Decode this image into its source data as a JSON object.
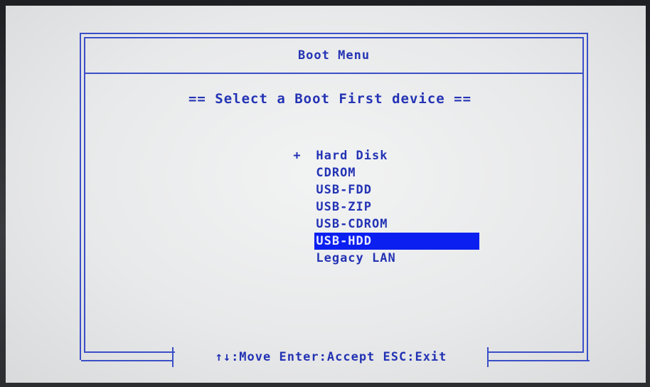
{
  "menu": {
    "title": "Boot Menu",
    "heading": "== Select a Boot First device ==",
    "marker": "+",
    "devices": [
      {
        "label": "Hard Disk",
        "marker": "+"
      },
      {
        "label": "CDROM",
        "marker": ""
      },
      {
        "label": "USB-FDD",
        "marker": ""
      },
      {
        "label": "USB-ZIP",
        "marker": ""
      },
      {
        "label": "USB-CDROM",
        "marker": ""
      },
      {
        "label": "USB-HDD",
        "marker": ""
      },
      {
        "label": "Legacy LAN",
        "marker": ""
      }
    ],
    "selected_label": "USB-HDD"
  },
  "help": {
    "text": "↑↓:Move Enter:Accept ESC:Exit"
  },
  "colors": {
    "text": "#2333b4",
    "border": "#3b4fc8",
    "highlight": "#0b1ff0",
    "background": "#e8e9ea"
  }
}
